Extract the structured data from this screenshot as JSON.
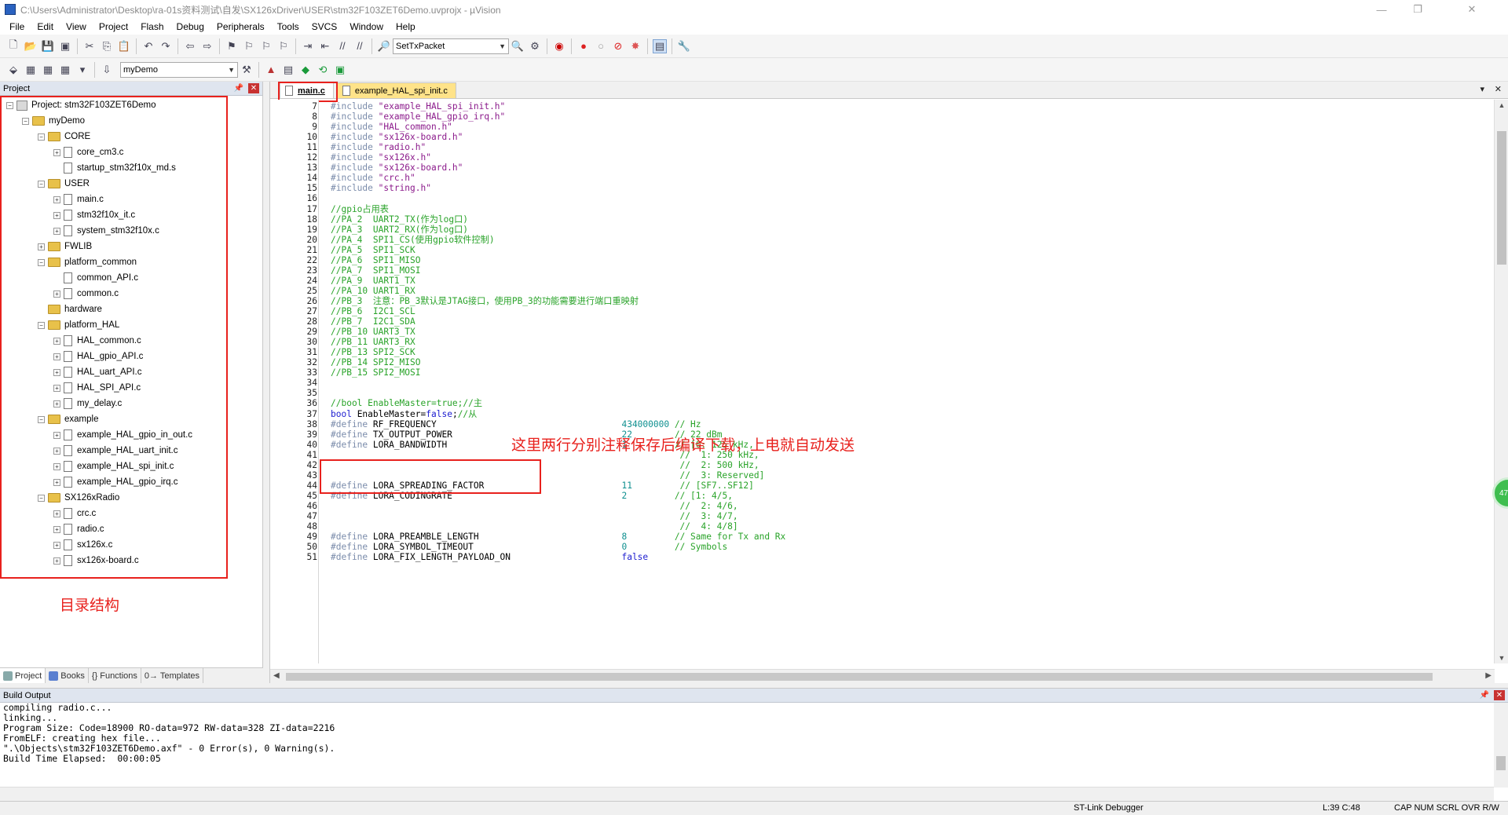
{
  "window": {
    "title": "C:\\Users\\Administrator\\Desktop\\ra-01s资料测试\\自发\\SX126xDriver\\USER\\stm32F103ZET6Demo.uvprojx - µVision",
    "controls": [
      "—",
      "❐",
      "✕"
    ]
  },
  "menu": [
    "File",
    "Edit",
    "View",
    "Project",
    "Flash",
    "Debug",
    "Peripherals",
    "Tools",
    "SVCS",
    "Window",
    "Help"
  ],
  "toolbar": {
    "find_combo": "SetTxPacket",
    "target_combo": "myDemo"
  },
  "project_panel": {
    "title": "Project",
    "pin": "📌",
    "close": "✕",
    "tree": [
      {
        "label": "Project: stm32F103ZET6Demo",
        "level": 0,
        "kind": "project",
        "toggle": "−"
      },
      {
        "label": "myDemo",
        "level": 1,
        "kind": "folder",
        "toggle": "−"
      },
      {
        "label": "CORE",
        "level": 2,
        "kind": "folder",
        "toggle": "−"
      },
      {
        "label": "core_cm3.c",
        "level": 3,
        "kind": "file",
        "toggle": "+"
      },
      {
        "label": "startup_stm32f10x_md.s",
        "level": 3,
        "kind": "file",
        "toggle": ""
      },
      {
        "label": "USER",
        "level": 2,
        "kind": "folder",
        "toggle": "−"
      },
      {
        "label": "main.c",
        "level": 3,
        "kind": "file",
        "toggle": "+"
      },
      {
        "label": "stm32f10x_it.c",
        "level": 3,
        "kind": "file",
        "toggle": "+"
      },
      {
        "label": "system_stm32f10x.c",
        "level": 3,
        "kind": "file",
        "toggle": "+"
      },
      {
        "label": "FWLIB",
        "level": 2,
        "kind": "folder",
        "toggle": "+"
      },
      {
        "label": "platform_common",
        "level": 2,
        "kind": "folder",
        "toggle": "−"
      },
      {
        "label": "common_API.c",
        "level": 3,
        "kind": "file",
        "toggle": ""
      },
      {
        "label": "common.c",
        "level": 3,
        "kind": "file",
        "toggle": "+"
      },
      {
        "label": "hardware",
        "level": 2,
        "kind": "folder",
        "toggle": ""
      },
      {
        "label": "platform_HAL",
        "level": 2,
        "kind": "folder",
        "toggle": "−"
      },
      {
        "label": "HAL_common.c",
        "level": 3,
        "kind": "file",
        "toggle": "+"
      },
      {
        "label": "HAL_gpio_API.c",
        "level": 3,
        "kind": "file",
        "toggle": "+"
      },
      {
        "label": "HAL_uart_API.c",
        "level": 3,
        "kind": "file",
        "toggle": "+"
      },
      {
        "label": "HAL_SPI_API.c",
        "level": 3,
        "kind": "file",
        "toggle": "+"
      },
      {
        "label": "my_delay.c",
        "level": 3,
        "kind": "file",
        "toggle": "+"
      },
      {
        "label": "example",
        "level": 2,
        "kind": "folder",
        "toggle": "−"
      },
      {
        "label": "example_HAL_gpio_in_out.c",
        "level": 3,
        "kind": "file",
        "toggle": "+"
      },
      {
        "label": "example_HAL_uart_init.c",
        "level": 3,
        "kind": "file",
        "toggle": "+"
      },
      {
        "label": "example_HAL_spi_init.c",
        "level": 3,
        "kind": "file",
        "toggle": "+"
      },
      {
        "label": "example_HAL_gpio_irq.c",
        "level": 3,
        "kind": "file",
        "toggle": "+"
      },
      {
        "label": "SX126xRadio",
        "level": 2,
        "kind": "folder",
        "toggle": "−"
      },
      {
        "label": "crc.c",
        "level": 3,
        "kind": "file",
        "toggle": "+"
      },
      {
        "label": "radio.c",
        "level": 3,
        "kind": "file",
        "toggle": "+"
      },
      {
        "label": "sx126x.c",
        "level": 3,
        "kind": "file",
        "toggle": "+"
      },
      {
        "label": "sx126x-board.c",
        "level": 3,
        "kind": "file",
        "toggle": "+"
      }
    ],
    "annotation": "目录结构",
    "tabs": [
      "Project",
      "Books",
      "{} Functions",
      "0→ Templates"
    ]
  },
  "editor": {
    "tabs": [
      "main.c",
      "example_HAL_spi_init.c"
    ],
    "tab_controls": [
      "▾",
      "✕"
    ],
    "annotation": "这里两行分别注释保存后编译下载，上电就自动发送",
    "lines": [
      {
        "n": "7",
        "seg": [
          [
            "pp",
            "#include "
          ],
          [
            "str",
            "\"example_HAL_spi_init.h\""
          ]
        ]
      },
      {
        "n": "8",
        "seg": [
          [
            "pp",
            "#include "
          ],
          [
            "str",
            "\"example_HAL_gpio_irq.h\""
          ]
        ]
      },
      {
        "n": "9",
        "seg": [
          [
            "pp",
            "#include "
          ],
          [
            "str",
            "\"HAL_common.h\""
          ]
        ]
      },
      {
        "n": "10",
        "seg": [
          [
            "pp",
            "#include "
          ],
          [
            "str",
            "\"sx126x-board.h\""
          ]
        ]
      },
      {
        "n": "11",
        "seg": [
          [
            "pp",
            "#include "
          ],
          [
            "str",
            "\"radio.h\""
          ]
        ]
      },
      {
        "n": "12",
        "seg": [
          [
            "pp",
            "#include "
          ],
          [
            "str",
            "\"sx126x.h\""
          ]
        ]
      },
      {
        "n": "13",
        "seg": [
          [
            "pp",
            "#include "
          ],
          [
            "str",
            "\"sx126x-board.h\""
          ]
        ]
      },
      {
        "n": "14",
        "seg": [
          [
            "pp",
            "#include "
          ],
          [
            "str",
            "\"crc.h\""
          ]
        ]
      },
      {
        "n": "15",
        "seg": [
          [
            "pp",
            "#include "
          ],
          [
            "str",
            "\"string.h\""
          ]
        ]
      },
      {
        "n": "16",
        "seg": []
      },
      {
        "n": "17",
        "seg": [
          [
            "cm",
            "//gpio占用表"
          ]
        ]
      },
      {
        "n": "18",
        "seg": [
          [
            "cm",
            "//PA_2  UART2_TX(作为log口)"
          ]
        ]
      },
      {
        "n": "19",
        "seg": [
          [
            "cm",
            "//PA_3  UART2_RX(作为log口)"
          ]
        ]
      },
      {
        "n": "20",
        "seg": [
          [
            "cm",
            "//PA_4  SPI1_CS(使用gpio软件控制)"
          ]
        ]
      },
      {
        "n": "21",
        "seg": [
          [
            "cm",
            "//PA_5  SPI1_SCK"
          ]
        ]
      },
      {
        "n": "22",
        "seg": [
          [
            "cm",
            "//PA_6  SPI1_MISO"
          ]
        ]
      },
      {
        "n": "23",
        "seg": [
          [
            "cm",
            "//PA_7  SPI1_MOSI"
          ]
        ]
      },
      {
        "n": "24",
        "seg": [
          [
            "cm",
            "//PA_9  UART1_TX"
          ]
        ]
      },
      {
        "n": "25",
        "seg": [
          [
            "cm",
            "//PA_10 UART1_RX"
          ]
        ]
      },
      {
        "n": "26",
        "seg": [
          [
            "cm",
            "//PB_3  注意：PB_3默认是JTAG接口，使用PB_3的功能需要进行端口重映射"
          ]
        ]
      },
      {
        "n": "27",
        "seg": [
          [
            "cm",
            "//PB_6  I2C1_SCL"
          ]
        ]
      },
      {
        "n": "28",
        "seg": [
          [
            "cm",
            "//PB_7  I2C1_SDA"
          ]
        ]
      },
      {
        "n": "29",
        "seg": [
          [
            "cm",
            "//PB_10 UART3_TX"
          ]
        ]
      },
      {
        "n": "30",
        "seg": [
          [
            "cm",
            "//PB_11 UART3_RX"
          ]
        ]
      },
      {
        "n": "31",
        "seg": [
          [
            "cm",
            "//PB_13 SPI2_SCK"
          ]
        ]
      },
      {
        "n": "32",
        "seg": [
          [
            "cm",
            "//PB_14 SPI2_MISO"
          ]
        ]
      },
      {
        "n": "33",
        "seg": [
          [
            "cm",
            "//PB_15 SPI2_MOSI"
          ]
        ]
      },
      {
        "n": "34",
        "seg": []
      },
      {
        "n": "35",
        "seg": []
      },
      {
        "n": "36",
        "seg": [
          [
            "cm",
            "//bool EnableMaster=true;//主"
          ]
        ]
      },
      {
        "n": "37",
        "seg": [
          [
            "kw",
            "bool"
          ],
          [
            "plain",
            " EnableMaster="
          ],
          [
            "kw",
            "false"
          ],
          [
            "plain",
            ";"
          ],
          [
            "cm",
            "//从"
          ]
        ]
      },
      {
        "n": "38",
        "seg": [
          [
            "pp",
            "#define "
          ],
          [
            "plain",
            "RF_FREQUENCY                                   "
          ],
          [
            "num",
            "434000000"
          ],
          [
            "cm",
            " // Hz"
          ]
        ]
      },
      {
        "n": "39",
        "seg": [
          [
            "pp",
            "#define "
          ],
          [
            "plain",
            "TX_OUTPUT_POWER                                "
          ],
          [
            "num",
            "22"
          ],
          [
            "cm",
            "        // 22 dBm"
          ]
        ]
      },
      {
        "n": "40",
        "seg": [
          [
            "pp",
            "#define "
          ],
          [
            "plain",
            "LORA_BANDWIDTH                                 "
          ],
          [
            "num",
            "1"
          ],
          [
            "cm",
            "         // [0: 125 kHz,"
          ]
        ]
      },
      {
        "n": "41",
        "seg": [
          [
            "cm",
            "                                                                  //  1: 250 kHz,"
          ]
        ]
      },
      {
        "n": "42",
        "seg": [
          [
            "cm",
            "                                                                  //  2: 500 kHz,"
          ]
        ]
      },
      {
        "n": "43",
        "seg": [
          [
            "cm",
            "                                                                  //  3: Reserved]"
          ]
        ]
      },
      {
        "n": "44",
        "seg": [
          [
            "pp",
            "#define "
          ],
          [
            "plain",
            "LORA_SPREADING_FACTOR                          "
          ],
          [
            "num",
            "11"
          ],
          [
            "cm",
            "         // [SF7..SF12]"
          ]
        ]
      },
      {
        "n": "45",
        "seg": [
          [
            "pp",
            "#define "
          ],
          [
            "plain",
            "LORA_CODINGRATE                                "
          ],
          [
            "num",
            "2"
          ],
          [
            "cm",
            "         // [1: 4/5,"
          ]
        ]
      },
      {
        "n": "46",
        "seg": [
          [
            "cm",
            "                                                                  //  2: 4/6,"
          ]
        ]
      },
      {
        "n": "47",
        "seg": [
          [
            "cm",
            "                                                                  //  3: 4/7,"
          ]
        ]
      },
      {
        "n": "48",
        "seg": [
          [
            "cm",
            "                                                                  //  4: 4/8]"
          ]
        ]
      },
      {
        "n": "49",
        "seg": [
          [
            "pp",
            "#define "
          ],
          [
            "plain",
            "LORA_PREAMBLE_LENGTH                           "
          ],
          [
            "num",
            "8"
          ],
          [
            "cm",
            "         // Same for Tx and Rx"
          ]
        ]
      },
      {
        "n": "50",
        "seg": [
          [
            "pp",
            "#define "
          ],
          [
            "plain",
            "LORA_SYMBOL_TIMEOUT                            "
          ],
          [
            "num",
            "0"
          ],
          [
            "cm",
            "         // Symbols"
          ]
        ]
      },
      {
        "n": "51",
        "seg": [
          [
            "pp",
            "#define "
          ],
          [
            "plain",
            "LORA_FIX_LENGTH_PAYLOAD_ON                     "
          ],
          [
            "kw",
            "false"
          ]
        ]
      }
    ],
    "badge": "47"
  },
  "build_output": {
    "title": "Build Output",
    "lines": [
      "compiling radio.c...",
      "linking...",
      "Program Size: Code=18900 RO-data=972 RW-data=328 ZI-data=2216",
      "FromELF: creating hex file...",
      "\".\\Objects\\stm32F103ZET6Demo.axf\" - 0 Error(s), 0 Warning(s).",
      "Build Time Elapsed:  00:00:05"
    ]
  },
  "status": {
    "debugger": "ST-Link Debugger",
    "position": "L:39 C:48",
    "flags": "CAP  NUM  SCRL  OVR  R/W"
  },
  "colors": {
    "annotation_red": "#e8211d",
    "comment_green": "#29a329",
    "string_purple": "#8b1a8b",
    "keyword_blue": "#2020d0",
    "number_teal": "#109090",
    "preproc_gray": "#7b8cab"
  }
}
